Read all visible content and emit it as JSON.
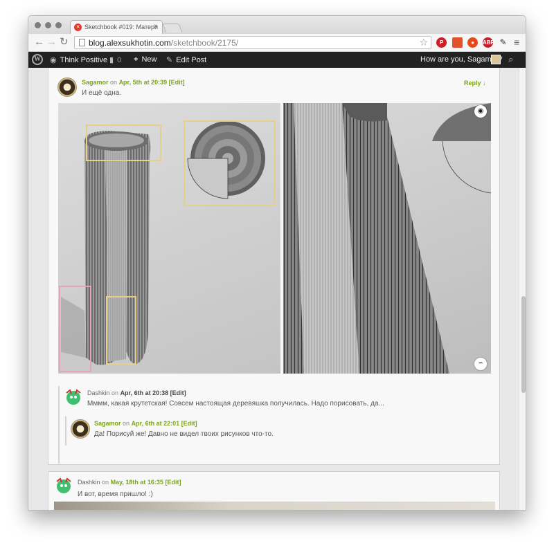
{
  "browser": {
    "tab_title": "Sketchbook #019: Матери",
    "tab_close": "×",
    "url_host": "blog.alexsukhotin.com",
    "url_path": "/sketchbook/2175/",
    "nav_back": "←",
    "nav_forward": "→",
    "nav_reload": "↻",
    "star": "☆",
    "menu": "≡",
    "extensions": [
      "pinterest-icon",
      "bookmark-icon",
      "download-icon",
      "adblock-icon",
      "script-icon"
    ]
  },
  "adminbar": {
    "site_name": "Think Positive",
    "comments_count": "0",
    "new_label": "New",
    "edit_post_label": "Edit Post",
    "howdy": "How are you, Sagamor?"
  },
  "comments": [
    {
      "author": "Sagamor",
      "on": "on",
      "date": "Apr, 5th at 20:39",
      "edit": "[Edit]",
      "reply": "Reply ↓",
      "text": "И ещё одна."
    },
    {
      "author": "Dashkin",
      "on": "on",
      "date": "Apr, 6th at 20:38",
      "edit": "[Edit]",
      "text": "Мммм, какая крутетская! Совсем настоящая деревяшка получилась. Надо порисовать, да..."
    },
    {
      "author": "Sagamor",
      "on": "on",
      "date": "Apr, 6th at 22:01",
      "edit": "[Edit]",
      "text": "Да! Порисуй же! Давно не видел твоих рисунков что-то."
    },
    {
      "author": "Dashkin",
      "on": "on",
      "date": "May, 18th at 16:35",
      "edit": "[Edit]",
      "text": "И вот, время пришло! :)"
    }
  ],
  "colors": {
    "accent_green": "#7aa514",
    "admin_bar": "#222222",
    "annotation_yellow": "#e6d089",
    "annotation_pink": "#e3a3b8"
  }
}
